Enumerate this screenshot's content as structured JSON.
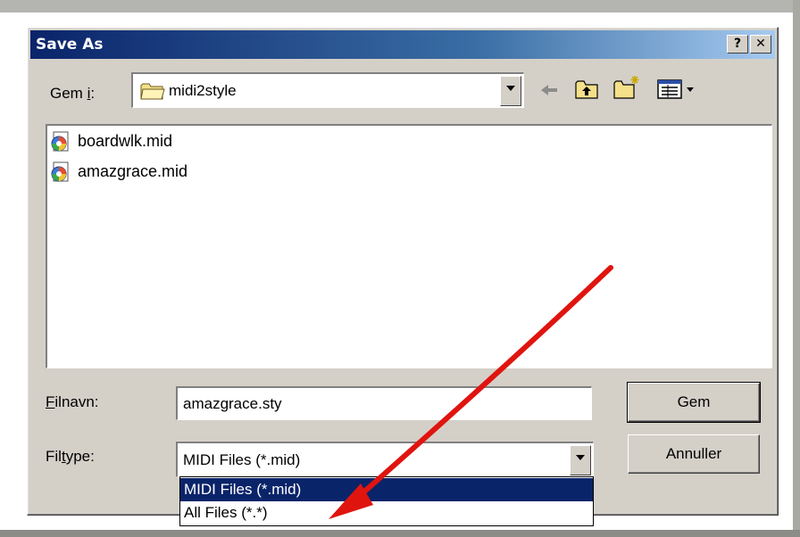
{
  "window": {
    "title": "Save As",
    "help_label": "?",
    "close_label": "✕"
  },
  "location": {
    "label_prefix": "Gem ",
    "label_hotkey": "i",
    "label_suffix": ":",
    "value": "midi2style"
  },
  "toolbar": {
    "back_icon": "back-arrow-icon",
    "up_icon": "up-folder-icon",
    "new_folder_icon": "new-folder-icon",
    "view_icon": "view-menu-icon"
  },
  "files": [
    {
      "name": "boardwlk.mid",
      "icon": "midi-file-icon"
    },
    {
      "name": "amazgrace.mid",
      "icon": "midi-file-icon"
    }
  ],
  "filename": {
    "label_hotkey": "F",
    "label_rest": "ilnavn:",
    "value": "amazgrace.sty"
  },
  "filetype": {
    "label_prefix": "Fil",
    "label_hotkey": "t",
    "label_rest": "ype:",
    "value": "MIDI Files (*.mid)",
    "options": [
      {
        "label": "MIDI Files (*.mid)",
        "selected": true
      },
      {
        "label": "All Files (*.*)",
        "selected": false
      }
    ]
  },
  "buttons": {
    "save": "Gem",
    "cancel": "Annuller"
  },
  "colors": {
    "dialog_face": "#d4d0c8",
    "title_start": "#0a246a",
    "title_end": "#a6caf0",
    "selection": "#0a246a",
    "annotation_arrow": "#e0140f"
  }
}
